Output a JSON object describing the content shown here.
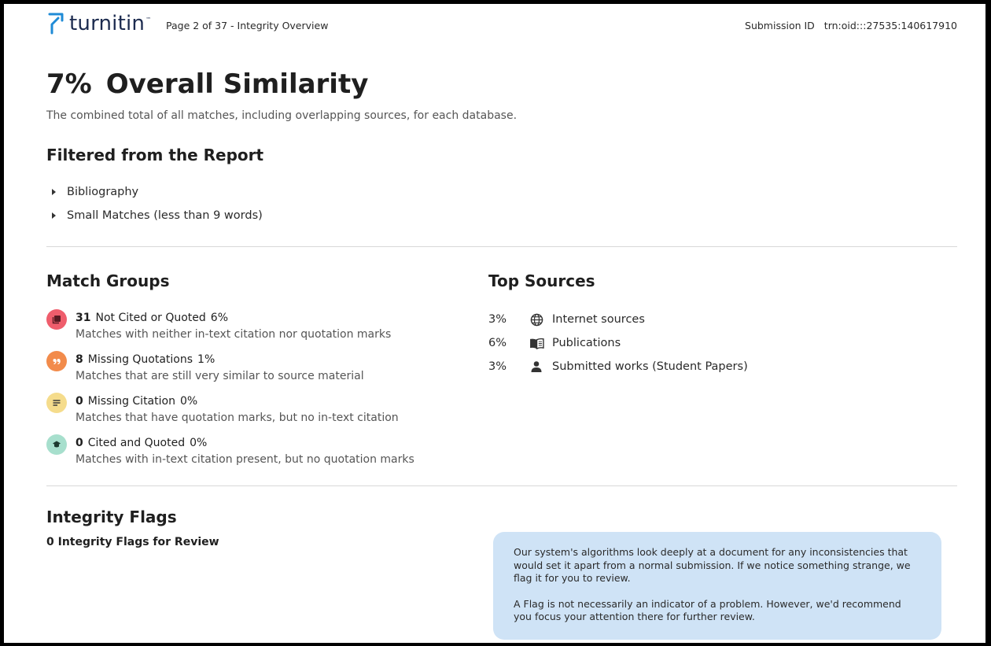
{
  "header": {
    "brand": "turnitin",
    "page_info": "Page 2 of 37 - Integrity Overview",
    "submission_label": "Submission ID",
    "submission_id": "trn:oid:::27535:140617910"
  },
  "overview": {
    "percent": "7%",
    "title": "Overall Similarity",
    "description": "The combined total of all matches, including overlapping sources, for each database."
  },
  "filtered": {
    "heading": "Filtered from the Report",
    "items": [
      "Bibliography",
      "Small Matches (less than 9 words)"
    ]
  },
  "match_groups": {
    "heading": "Match Groups",
    "items": [
      {
        "count": "31",
        "label": "Not Cited or Quoted",
        "percent": "6%",
        "description": "Matches with neither in-text citation nor quotation marks",
        "icon": "document-stack-icon",
        "color": "#ef5d6c",
        "icon_color": "#5a1a22"
      },
      {
        "count": "8",
        "label": "Missing Quotations",
        "percent": "1%",
        "description": "Matches that are still very similar to source material",
        "icon": "quotation-marks-icon",
        "color": "#f28b4b",
        "icon_color": "#ffffff"
      },
      {
        "count": "0",
        "label": "Missing Citation",
        "percent": "0%",
        "description": "Matches that have quotation marks, but no in-text citation",
        "icon": "text-lines-icon",
        "color": "#f5dc8c",
        "icon_color": "#3b3b3b"
      },
      {
        "count": "0",
        "label": "Cited and Quoted",
        "percent": "0%",
        "description": "Matches with in-text citation present, but no quotation marks",
        "icon": "graduation-cap-icon",
        "color": "#a7dfcd",
        "icon_color": "#1d3a30"
      }
    ]
  },
  "top_sources": {
    "heading": "Top Sources",
    "items": [
      {
        "percent": "3%",
        "label": "Internet sources",
        "icon": "globe-icon"
      },
      {
        "percent": "6%",
        "label": "Publications",
        "icon": "open-book-icon"
      },
      {
        "percent": "3%",
        "label": "Submitted works (Student Papers)",
        "icon": "person-icon"
      }
    ]
  },
  "integrity_flags": {
    "heading": "Integrity Flags",
    "count_text": "0 Integrity Flags for Review",
    "info_paragraphs": [
      "Our system's algorithms look deeply at a document for any inconsistencies that would set it apart from a normal submission. If we notice something strange, we flag it for you to review.",
      "A Flag is not necessarily an indicator of a problem. However, we'd recommend you focus your attention there for further review."
    ]
  },
  "colors": {
    "brand_blue": "#1f8bd6",
    "brand_text": "#1c2b4f",
    "info_box": "#cfe3f6"
  }
}
